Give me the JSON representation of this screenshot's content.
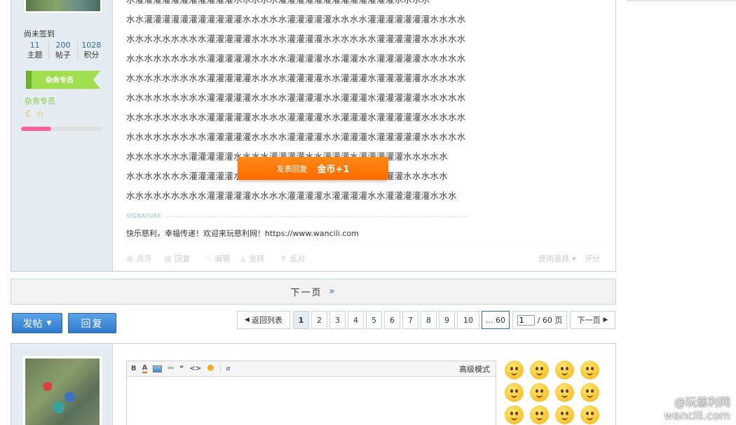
{
  "author": {
    "checkin": "尚未签到",
    "stats": [
      {
        "num": "11",
        "label": "主题"
      },
      {
        "num": "200",
        "label": "帖子"
      },
      {
        "num": "1028",
        "label": "积分"
      }
    ],
    "rank_badge": "杂务专员",
    "rank_name": "杂务专员",
    "credit_progress": 0.37
  },
  "post": {
    "lines": [
      "水灌灌灌灌灌灌灌灌灌灌灌水水水水水灌灌灌灌灌灌灌灌灌灌灌灌灌水水水水",
      "水水灌灌灌灌灌灌灌灌灌灌灌水水水水水灌灌灌灌灌水水水水灌灌灌灌灌灌灌水水水水",
      "水水水水水水水水水灌灌灌灌灌水水水水灌灌灌灌水水水水水水灌灌灌灌灌水水水水水",
      "水水水水水水水水水灌灌灌灌灌水水水水灌灌灌灌水水灌灌水水灌灌灌灌灌水水水水水",
      "水水水水水水水水水灌灌灌灌灌水水水水灌灌灌灌水水灌灌灌水灌灌灌灌灌水水水水水",
      "水水水水水水水水水灌灌灌灌灌水水水水灌灌灌灌水水灌灌灌水灌灌灌灌灌水水水水水",
      "水水水水水水水水水灌灌灌灌灌水水水水灌灌灌灌水水灌灌灌水灌灌灌灌灌水水水水水",
      "水水水水水水水水水灌灌灌灌灌水水水水灌灌灌灌水水灌灌灌水灌灌灌灌灌水水水水水",
      "水水水水水水水灌灌灌灌灌水水水水灌灌灌灌水水灌灌灌水灌灌灌灌灌水水水水水",
      "水水水水水水水灌灌灌灌灌水水水水灌灌灌灌水水灌灌灌水灌灌灌灌灌水水水水水",
      "水水水水水水水水水灌灌灌灌灌水水水水灌灌灌灌水灌灌灌灌水水灌灌灌灌灌水水水"
    ],
    "signature_label": "SIGNATURE",
    "signature_text": "快乐慈利，幸福传递！欢迎来玩慈利网！https://www.wancili.com",
    "actions": {
      "rate": "点评",
      "reply": "回复",
      "edit": "编辑",
      "support": "支持",
      "oppose": "反对",
      "tools": "使用道具",
      "score": "评分"
    }
  },
  "toast": {
    "label": "发表回复",
    "reward": "金币+1"
  },
  "next_bar": {
    "label": "下一页",
    "arrow": "»"
  },
  "buttons": {
    "post": "发帖",
    "reply": "回复"
  },
  "pager": {
    "back": "返回列表",
    "pages": [
      "1",
      "2",
      "3",
      "4",
      "5",
      "6",
      "7",
      "8",
      "9",
      "10"
    ],
    "last": "... 60",
    "input_value": "1",
    "total": "/ 60 页",
    "next": "下一页"
  },
  "editor": {
    "advanced": "高级模式",
    "tools": [
      "bold-icon",
      "font-color-icon",
      "image-icon",
      "link-icon",
      "quote-icon",
      "code-icon",
      "smiley-icon",
      "attach-icon"
    ]
  },
  "watermark": {
    "line1": "@玩慈利网",
    "line2": "wancili.com"
  }
}
